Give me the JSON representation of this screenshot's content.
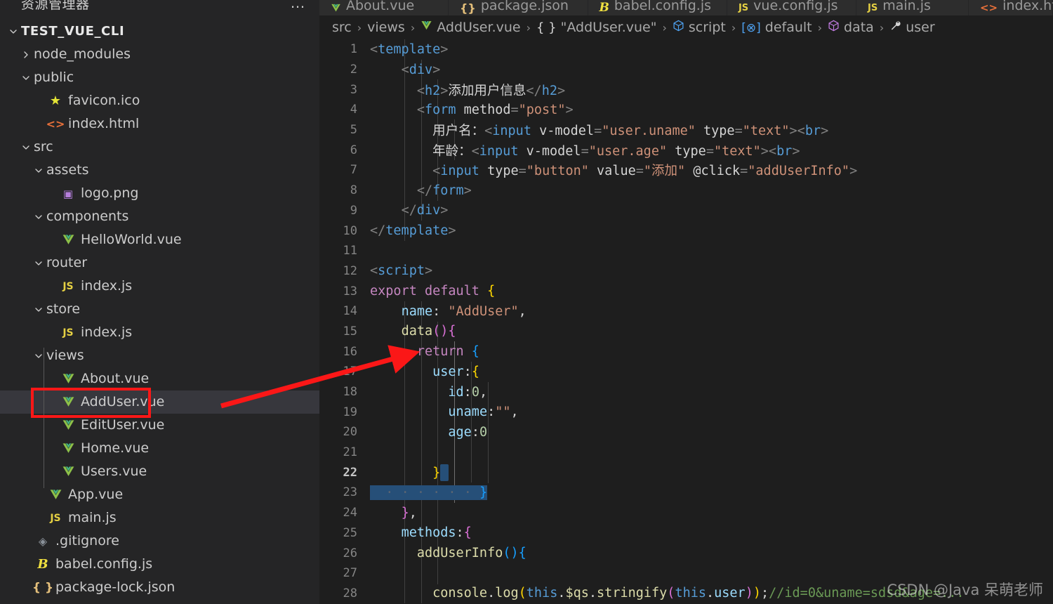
{
  "sidebar": {
    "title": "资源管理器",
    "more_label": "…",
    "root": "TEST_VUE_CLI",
    "items": [
      {
        "label": "node_modules",
        "type": "folder",
        "state": "collapsed",
        "indent": 1
      },
      {
        "label": "public",
        "type": "folder",
        "state": "expanded",
        "indent": 1
      },
      {
        "label": "favicon.ico",
        "type": "star",
        "indent": 2
      },
      {
        "label": "index.html",
        "type": "html",
        "indent": 2
      },
      {
        "label": "src",
        "type": "folder",
        "state": "expanded",
        "indent": 1
      },
      {
        "label": "assets",
        "type": "folder",
        "state": "expanded",
        "indent": 2
      },
      {
        "label": "logo.png",
        "type": "image",
        "indent": 3
      },
      {
        "label": "components",
        "type": "folder",
        "state": "expanded",
        "indent": 2
      },
      {
        "label": "HelloWorld.vue",
        "type": "vue",
        "indent": 3
      },
      {
        "label": "router",
        "type": "folder",
        "state": "expanded",
        "indent": 2
      },
      {
        "label": "index.js",
        "type": "js",
        "indent": 3
      },
      {
        "label": "store",
        "type": "folder",
        "state": "expanded",
        "indent": 2
      },
      {
        "label": "index.js",
        "type": "js",
        "indent": 3
      },
      {
        "label": "views",
        "type": "folder",
        "state": "expanded",
        "indent": 2
      },
      {
        "label": "About.vue",
        "type": "vue",
        "indent": 3
      },
      {
        "label": "AddUser.vue",
        "type": "vue",
        "indent": 3,
        "active": true,
        "highlighted": true
      },
      {
        "label": "EditUser.vue",
        "type": "vue",
        "indent": 3
      },
      {
        "label": "Home.vue",
        "type": "vue",
        "indent": 3
      },
      {
        "label": "Users.vue",
        "type": "vue",
        "indent": 3
      },
      {
        "label": "App.vue",
        "type": "vue",
        "indent": 2
      },
      {
        "label": "main.js",
        "type": "js",
        "indent": 2
      },
      {
        "label": ".gitignore",
        "type": "git",
        "indent": 1
      },
      {
        "label": "babel.config.js",
        "type": "babel",
        "indent": 1
      },
      {
        "label": "package-lock.json",
        "type": "json",
        "indent": 1
      }
    ]
  },
  "tabs": [
    {
      "label": "About.vue",
      "icon": "vue-icon",
      "active": false
    },
    {
      "label": "package.json",
      "icon": "json-icon",
      "active": false
    },
    {
      "label": "babel.config.js",
      "icon": "babel-icon",
      "active": false
    },
    {
      "label": "vue.config.js",
      "icon": "js-icon",
      "active": false
    },
    {
      "label": "main.js",
      "icon": "js-icon",
      "active": false
    },
    {
      "label": "index.html",
      "icon": "html-icon",
      "active": false
    }
  ],
  "breadcrumb": [
    {
      "label": "src",
      "icon": null
    },
    {
      "label": "views",
      "icon": null
    },
    {
      "label": "AddUser.vue",
      "icon": "vue-icon"
    },
    {
      "label": "\"AddUser.vue\"",
      "icon": "braces-icon"
    },
    {
      "label": "script",
      "icon": "cube-blue-icon"
    },
    {
      "label": "default",
      "icon": "export-icon"
    },
    {
      "label": "data",
      "icon": "cube-purple-icon"
    },
    {
      "label": "user",
      "icon": "wrench-icon"
    }
  ],
  "code": {
    "current_line": 22,
    "lines": [
      {
        "n": 1,
        "indent": 0
      },
      {
        "n": 2,
        "indent": 1
      },
      {
        "n": 3,
        "indent": 2
      },
      {
        "n": 4,
        "indent": 2
      },
      {
        "n": 5,
        "indent": 3
      },
      {
        "n": 6,
        "indent": 3
      },
      {
        "n": 7,
        "indent": 3
      },
      {
        "n": 8,
        "indent": 2
      },
      {
        "n": 9,
        "indent": 1
      },
      {
        "n": 10,
        "indent": 0
      },
      {
        "n": 11,
        "indent": 0
      },
      {
        "n": 12,
        "indent": 0
      },
      {
        "n": 13,
        "indent": 0
      },
      {
        "n": 14,
        "indent": 1
      },
      {
        "n": 15,
        "indent": 1
      },
      {
        "n": 16,
        "indent": 2
      },
      {
        "n": 17,
        "indent": 3
      },
      {
        "n": 18,
        "indent": 4
      },
      {
        "n": 19,
        "indent": 4
      },
      {
        "n": 20,
        "indent": 4
      },
      {
        "n": 21,
        "indent": 4
      },
      {
        "n": 22,
        "indent": 3
      },
      {
        "n": 23,
        "indent": 2
      },
      {
        "n": 24,
        "indent": 1
      },
      {
        "n": 25,
        "indent": 1
      },
      {
        "n": 26,
        "indent": 2
      },
      {
        "n": 27,
        "indent": 3
      },
      {
        "n": 28,
        "indent": 3
      }
    ],
    "text": [
      "<template>",
      "    <div>",
      "      <h2>添加用户信息</h2>",
      "      <form method=\"post\">",
      "        用户名：<input v-model=\"user.uname\" type=\"text\"><br>",
      "        年龄：<input v-model=\"user.age\" type=\"text\"><br>",
      "        <input type=\"button\" value=\"添加\" @click=\"addUserInfo\">",
      "      </form>",
      "    </div>",
      "</template>",
      "",
      "<script>",
      "export default {",
      "    name: \"AddUser\",",
      "    data(){",
      "      return {",
      "        user:{",
      "          id:0,",
      "          uname:\"\",",
      "          age:0",
      "",
      "        }",
      "      }",
      "    },",
      "    methods:{",
      "      addUserInfo(){",
      "",
      "        console.log(this.$qs.stringify(this.user));//id=0&uname=sdsd&age=..."
    ]
  },
  "watermark": "CSDN @Java 呆萌老师"
}
